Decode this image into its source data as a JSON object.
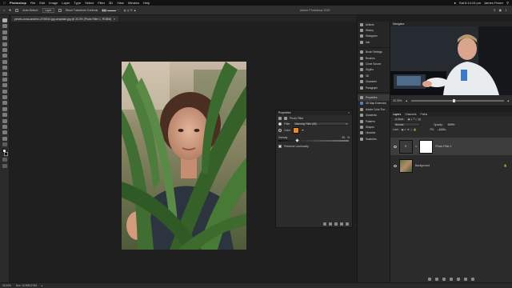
{
  "menubar": {
    "app_name": "Photoshop",
    "items": [
      "File",
      "Edit",
      "Image",
      "Layer",
      "Type",
      "Select",
      "Filter",
      "3D",
      "View",
      "Window",
      "Help"
    ],
    "clock": "Sat 6:14:15 pm",
    "user": "James Fewer"
  },
  "options_bar": {
    "auto_select_label": "Auto-Select:",
    "auto_select_value": "Layer",
    "show_transform_label": "Show Transform Controls",
    "window_title": "Adobe Photoshop 2020"
  },
  "document_tab": {
    "label": "pexels-anna-andrew-4709044.jpg-unsplash.jpg @ 33.3% (Photo Filter 1, RGB/8)"
  },
  "properties": {
    "title": "Properties",
    "adjustment_name": "Photo Filter",
    "filter_label": "Filter",
    "filter_value": "Warming Filter (85)",
    "color_label": "Color",
    "density_label": "Density",
    "density_value": "25",
    "density_percent": "%",
    "preserve_label": "Preserve Luminosity",
    "accent_color": "#ec8a1d"
  },
  "dock": {
    "items": [
      "Actions",
      "History",
      "Histogram",
      "Info",
      "Brush Settings",
      "Brushes",
      "Clone Source",
      "Glyphs",
      "3D",
      "Character",
      "Paragraph",
      "Properties",
      "3D Map Extension",
      "Adobe Color The...",
      "Gradients",
      "Patterns",
      "Shapes",
      "Libraries",
      "Swatches"
    ],
    "active_index": 11
  },
  "navigator": {
    "title": "Navigator",
    "zoom": "33.33%"
  },
  "layers": {
    "tabs": [
      "Layers",
      "Channels",
      "Paths"
    ],
    "kind_label": "Kind",
    "blend_mode": "Normal",
    "opacity_label": "Opacity:",
    "opacity_value": "100%",
    "lock_label": "Lock:",
    "fill_label": "Fill:",
    "fill_value": "100%",
    "items": [
      {
        "name": "Photo Filter 1"
      },
      {
        "name": "Background"
      }
    ]
  },
  "status": {
    "zoom": "33.33%",
    "doc_info": "Doc: 12.9M/12.9M"
  }
}
